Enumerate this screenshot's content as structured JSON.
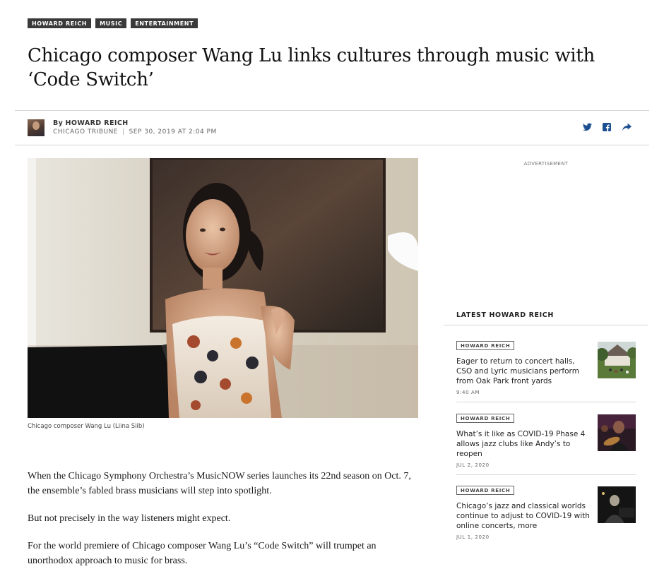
{
  "tags": [
    "HOWARD REICH",
    "MUSIC",
    "ENTERTAINMENT"
  ],
  "headline": "Chicago composer Wang Lu links cultures through music with ‘Code Switch’",
  "byline": {
    "by_prefix": "By",
    "author": "HOWARD REICH",
    "outlet": "CHICAGO TRIBUNE",
    "separator": "|",
    "date": "SEP 30, 2019 AT 2:04 PM"
  },
  "share_icons": [
    "twitter-icon",
    "facebook-icon",
    "share-arrow-icon"
  ],
  "photo": {
    "caption": "Chicago composer Wang Lu (Liina Siib)"
  },
  "body": {
    "paragraphs": [
      "When the Chicago Symphony Orchestra’s MusicNOW series launches its 22nd season on Oct. 7, the ensemble’s fabled brass musicians will step into spotlight.",
      "But not precisely in the way listeners might expect.",
      "For the world premiere of Chicago composer Wang Lu’s “Code Switch” will trumpet an unorthodox approach to music for brass."
    ]
  },
  "sidebar": {
    "ad_label": "ADVERTISEMENT",
    "latest_title": "LATEST HOWARD REICH",
    "stories": [
      {
        "tag": "HOWARD REICH",
        "headline": "Eager to return to concert halls, CSO and Lyric musicians perform from Oak Park front yards",
        "time": "9:40 AM"
      },
      {
        "tag": "HOWARD REICH",
        "headline": "What’s it like as COVID-19 Phase 4 allows jazz clubs like Andy’s to reopen",
        "time": "JUL 2, 2020"
      },
      {
        "tag": "HOWARD REICH",
        "headline": "Chicago’s jazz and classical worlds continue to adjust to COVID-19 with online concerts, more",
        "time": "JUL 1, 2020"
      }
    ]
  },
  "colors": {
    "tag_bg": "#3a3a3a",
    "share_icon": "#1c4f8f",
    "rule": "#d6d6d6"
  }
}
